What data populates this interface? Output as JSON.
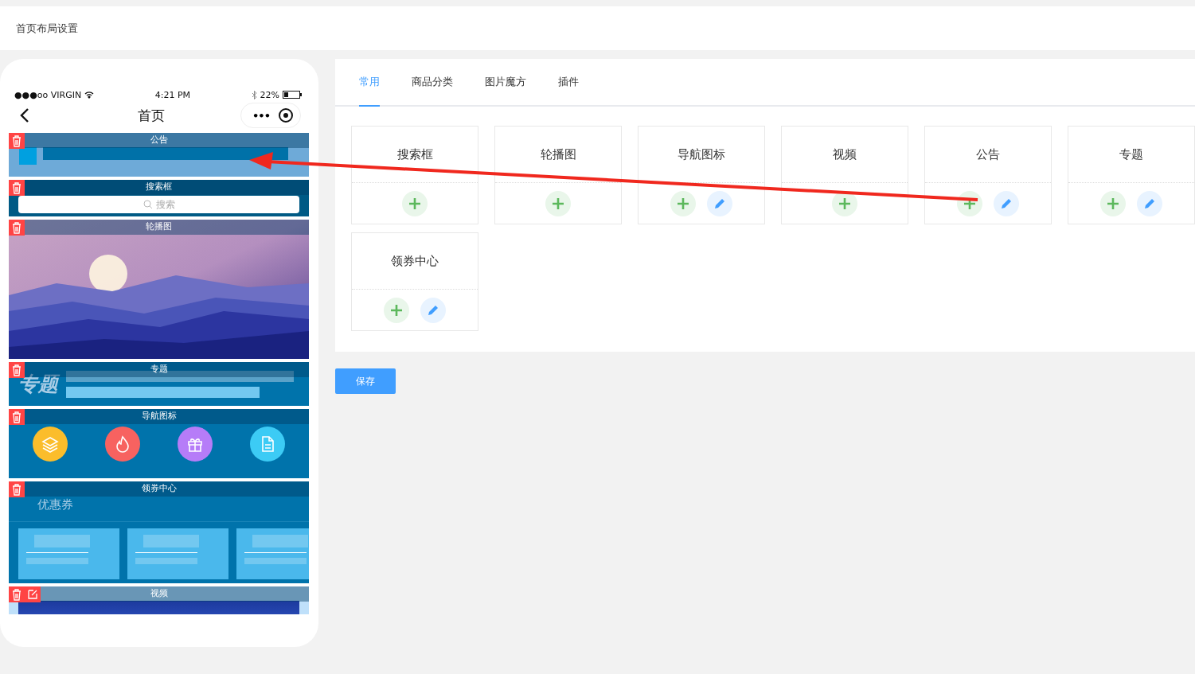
{
  "header": {
    "title": "首页布局设置"
  },
  "phone": {
    "status": {
      "carrier": "●●●oo VIRGIN",
      "time": "4:21 PM",
      "battery": "22%"
    },
    "nav_title": "首页",
    "more": "•••",
    "modules": [
      {
        "kind": "notice",
        "label": "公告",
        "editable": false
      },
      {
        "kind": "search",
        "label": "搜索框",
        "editable": false,
        "placeholder": "搜索"
      },
      {
        "kind": "banner",
        "label": "轮播图",
        "editable": false
      },
      {
        "kind": "topic",
        "label": "专题",
        "editable": false,
        "art_text": "专题"
      },
      {
        "kind": "nav",
        "label": "导航图标",
        "editable": false,
        "icons": [
          {
            "kind": "layers",
            "color": "#fbbd2b"
          },
          {
            "kind": "fire",
            "color": "#f76260"
          },
          {
            "kind": "gift",
            "color": "#b67cf8"
          },
          {
            "kind": "doc",
            "color": "#3ccbf5"
          }
        ]
      },
      {
        "kind": "coupon",
        "label": "领券中心",
        "editable": false,
        "caption": "优惠券"
      },
      {
        "kind": "video",
        "label": "视频",
        "editable": true
      }
    ]
  },
  "tabs": [
    {
      "label": "常用",
      "selected": true
    },
    {
      "label": "商品分类",
      "selected": false
    },
    {
      "label": "图片魔方",
      "selected": false
    },
    {
      "label": "插件",
      "selected": false
    }
  ],
  "components": [
    {
      "label": "搜索框",
      "editable": false
    },
    {
      "label": "轮播图",
      "editable": false
    },
    {
      "label": "导航图标",
      "editable": true
    },
    {
      "label": "视频",
      "editable": false
    },
    {
      "label": "公告",
      "editable": true
    },
    {
      "label": "专题",
      "editable": true
    },
    {
      "label": "领券中心",
      "editable": true
    }
  ],
  "save_button": "保存"
}
